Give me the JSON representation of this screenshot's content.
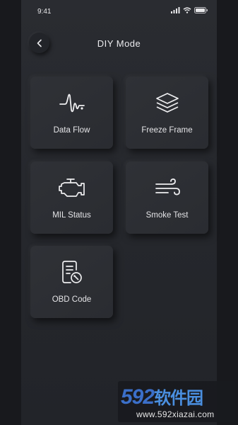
{
  "status_bar": {
    "time": "9:41"
  },
  "header": {
    "title": "DIY Mode"
  },
  "tiles": [
    {
      "label": "Data Flow",
      "icon": "waveform-icon"
    },
    {
      "label": "Freeze Frame",
      "icon": "layers-icon"
    },
    {
      "label": "MIL Status",
      "icon": "engine-icon"
    },
    {
      "label": "Smoke Test",
      "icon": "wind-icon"
    },
    {
      "label": "OBD Code",
      "icon": "document-wrench-icon"
    }
  ],
  "watermark": {
    "logo_num": "592",
    "logo_text": "软件园",
    "url": "www.592xiazai.com"
  },
  "colors": {
    "background": "#25272c",
    "tile": "#2d2f34",
    "text": "#e4e4e7",
    "watermark_blue": "#3b6fc9"
  }
}
